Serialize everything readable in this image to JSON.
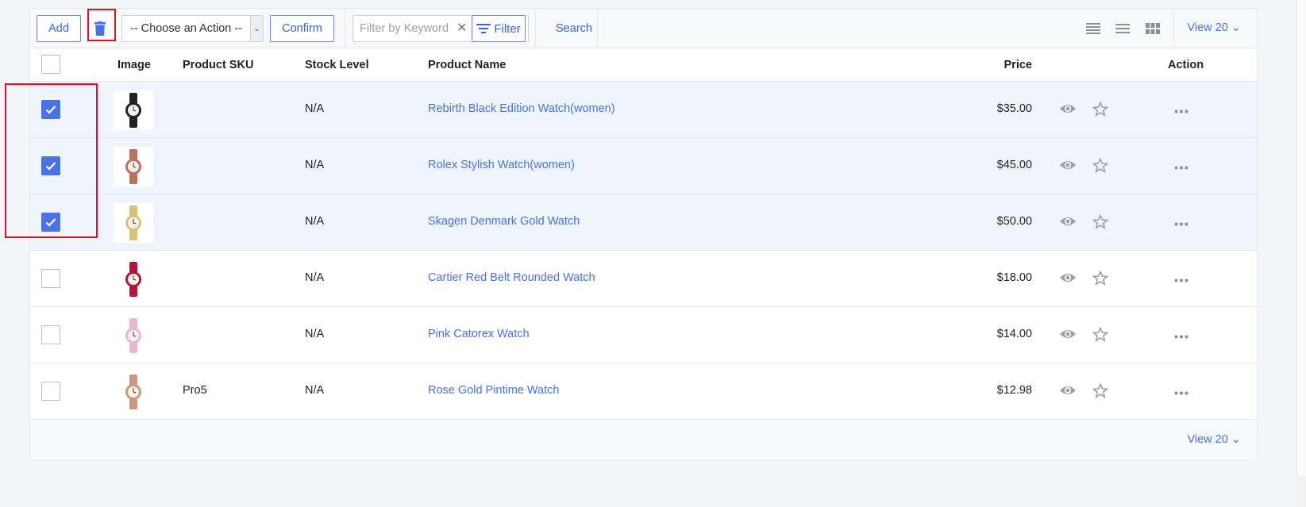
{
  "toolbar": {
    "add_label": "Add",
    "action_select_value": "-- Choose an Action --",
    "confirm_label": "Confirm",
    "keyword_placeholder": "Filter by Keyword",
    "filter_label": "Filter",
    "search_label": "Search",
    "view_count_label": "View 20 ⌄"
  },
  "table": {
    "columns": {
      "image": "Image",
      "sku": "Product SKU",
      "stock": "Stock Level",
      "name": "Product Name",
      "price": "Price",
      "action": "Action"
    },
    "rows": [
      {
        "checked": true,
        "sku": "",
        "stock": "N/A",
        "name": "Rebirth Black Edition Watch(women)",
        "price": "$35.00",
        "watch_color": "#222222"
      },
      {
        "checked": true,
        "sku": "",
        "stock": "N/A",
        "name": "Rolex Stylish Watch(women)",
        "price": "$45.00",
        "watch_color": "#b9735e"
      },
      {
        "checked": true,
        "sku": "",
        "stock": "N/A",
        "name": "Skagen Denmark Gold Watch",
        "price": "$50.00",
        "watch_color": "#d8c27a"
      },
      {
        "checked": false,
        "sku": "",
        "stock": "N/A",
        "name": "Cartier Red Belt Rounded Watch",
        "price": "$18.00",
        "watch_color": "#b0173a"
      },
      {
        "checked": false,
        "sku": "",
        "stock": "N/A",
        "name": "Pink Catorex Watch",
        "price": "$14.00",
        "watch_color": "#e7b8d0"
      },
      {
        "checked": false,
        "sku": "Pro5",
        "stock": "N/A",
        "name": "Rose Gold Pintime Watch",
        "price": "$12.98",
        "watch_color": "#c99782"
      }
    ]
  },
  "footer": {
    "view_count_label": "View 20 ⌄"
  },
  "colors": {
    "accent": "#4a72e0",
    "highlight": "#e0141e",
    "selected_row": "#eff5fd"
  }
}
